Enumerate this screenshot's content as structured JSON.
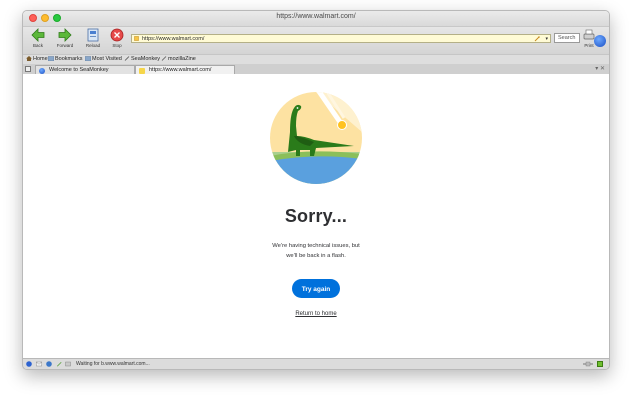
{
  "window": {
    "title": "https://www.walmart.com/"
  },
  "toolbar": {
    "back_label": "Back",
    "forward_label": "Forward",
    "reload_label": "Reload",
    "stop_label": "Stop",
    "url_value": "https://www.walmart.com/",
    "search_placeholder": "Search",
    "print_label": "Print"
  },
  "bookmarks": {
    "items": [
      {
        "label": "Home",
        "icon": "home-icon"
      },
      {
        "label": "Bookmarks",
        "icon": "folder-icon"
      },
      {
        "label": "Most Visited",
        "icon": "folder-icon"
      },
      {
        "label": "SeaMonkey",
        "icon": "bookmark-icon"
      },
      {
        "label": "mozillaZine",
        "icon": "bookmark-icon"
      }
    ]
  },
  "tabs": [
    {
      "label": "Welcome to SeaMonkey",
      "active": false
    },
    {
      "label": "https://www.walmart.com/",
      "active": true
    }
  ],
  "page": {
    "heading": "Sorry...",
    "message_line1": "We’re having technical issues, but",
    "message_line2": "we’ll be back in a flash.",
    "try_again_label": "Try again",
    "return_link_label": "Return to home"
  },
  "status": {
    "text": "Waiting for b.www.walmart.com..."
  },
  "colors": {
    "accent": "#0071dc",
    "heading": "#2e2f32",
    "urlbar_bg": "#fffbd5"
  }
}
